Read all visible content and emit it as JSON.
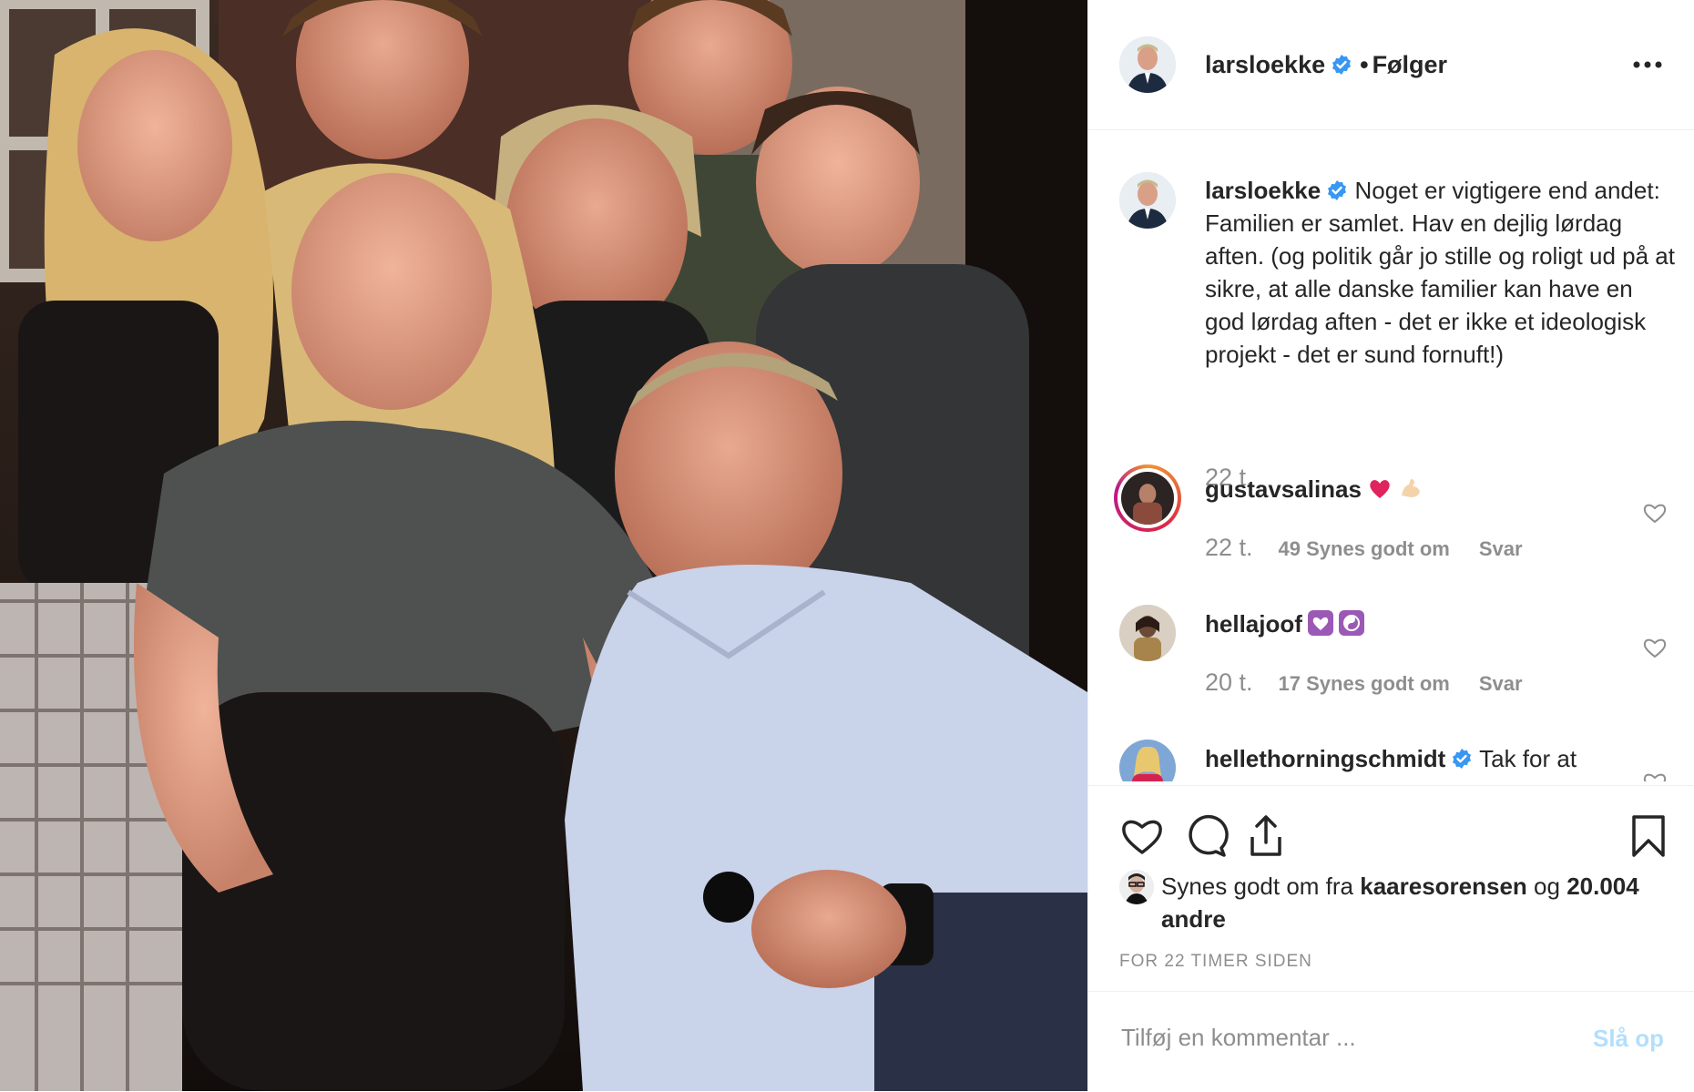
{
  "post_author": {
    "username": "larsloekke",
    "verified": true,
    "follow_separator": "•",
    "follow_label": "Følger"
  },
  "caption": {
    "username": "larsloekke",
    "text": "Noget er vigtigere end andet: Familien er samlet. Hav en dejlig lørdag aften. (og politik går jo stille og roligt ud på at sikre, at alle danske familier kan have en god lørdag aften - det er ikke et ideologisk projekt - det er sund fornuft!)",
    "time": "22 t."
  },
  "comments": [
    {
      "username": "gustavsalinas",
      "text": "",
      "emojis": [
        "red-heart",
        "flexed-biceps"
      ],
      "time": "22 t.",
      "likes": "49 Synes godt om",
      "reply": "Svar",
      "has_story": true
    },
    {
      "username": "hellajoof",
      "text": "",
      "emojis": [
        "purple-heart",
        "yin-yang"
      ],
      "time": "20 t.",
      "likes": "17 Synes godt om",
      "reply": "Svar",
      "has_story": false
    },
    {
      "username": "hellethorningschmidt",
      "verified": true,
      "text": "Tak for at"
    }
  ],
  "liked_by": {
    "prefix": "Synes godt om fra",
    "user": "kaaresorensen",
    "joiner": "og",
    "others": "20.004 andre"
  },
  "timestamp": "FOR 22 TIMER SIDEN",
  "add_comment": {
    "placeholder": "Tilføj en kommentar ...",
    "post_label": "Slå op"
  },
  "icons": {
    "more": "more-horizontal-icon",
    "like": "heart-icon",
    "comment": "comment-bubble-icon",
    "share": "share-icon",
    "save": "bookmark-icon",
    "verified": "verified-badge-icon"
  },
  "colors": {
    "verified": "#3897f0",
    "text": "#262626",
    "muted": "#8e8e8e",
    "post_disabled": "#b2dffc",
    "border": "#efefef"
  }
}
